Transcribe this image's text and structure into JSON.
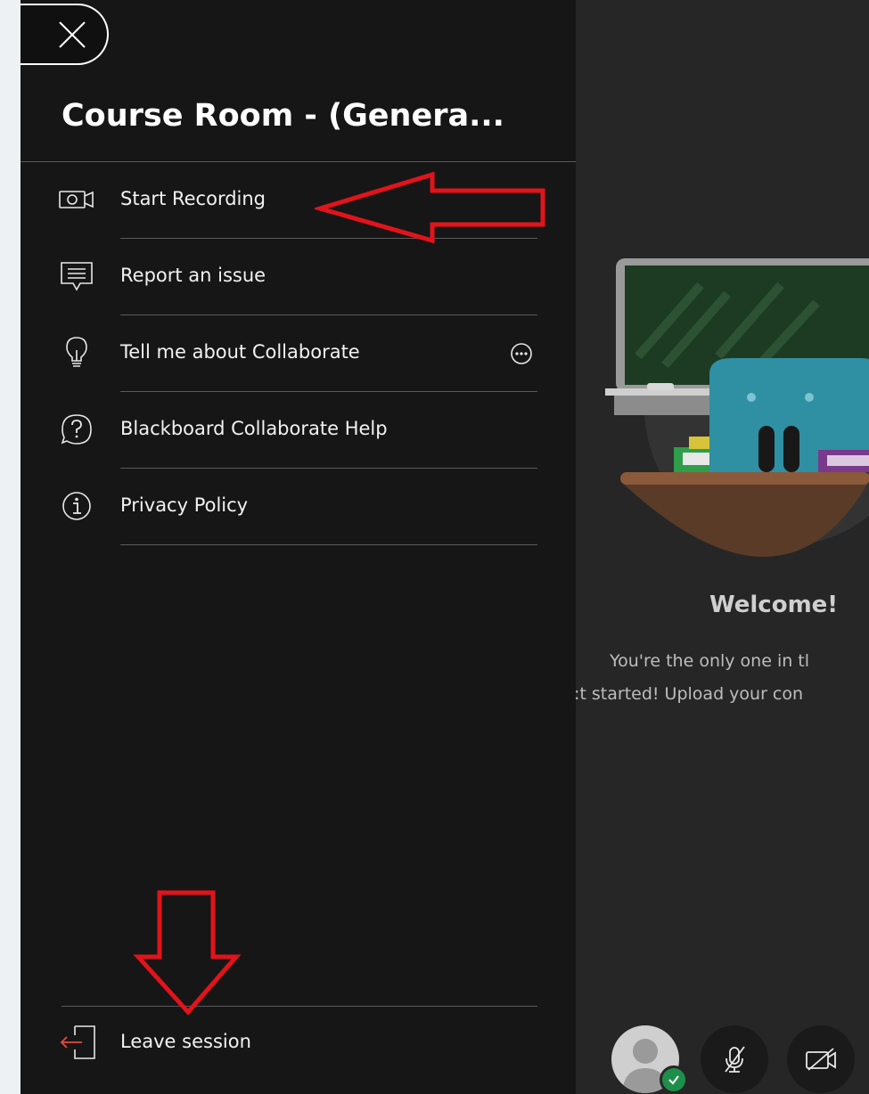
{
  "panel": {
    "close_icon": "close-icon",
    "title": "Course Room - (Genera...",
    "menu": [
      {
        "id": "start-recording",
        "label": "Start Recording",
        "icon": "video-camera-icon"
      },
      {
        "id": "report-issue",
        "label": "Report an issue",
        "icon": "chat-bubble-icon"
      },
      {
        "id": "tell-me-about",
        "label": "Tell me about Collaborate",
        "icon": "lightbulb-icon",
        "more_icon": "more-options-icon"
      },
      {
        "id": "help",
        "label": "Blackboard Collaborate Help",
        "icon": "help-icon"
      },
      {
        "id": "privacy",
        "label": "Privacy Policy",
        "icon": "info-icon"
      }
    ],
    "leave_label": "Leave session",
    "leave_icon": "leave-session-icon"
  },
  "stage": {
    "welcome_title": "Welcome!",
    "welcome_line_1": "You're the only one in tl",
    "welcome_line_2": ":t started! Upload your con"
  },
  "colors": {
    "panel_bg": "#161616",
    "stage_bg": "#262626",
    "annotation_red": "#e3131b",
    "leave_icon_accent": "#e54b3f",
    "status_green": "#1d8f4a"
  }
}
